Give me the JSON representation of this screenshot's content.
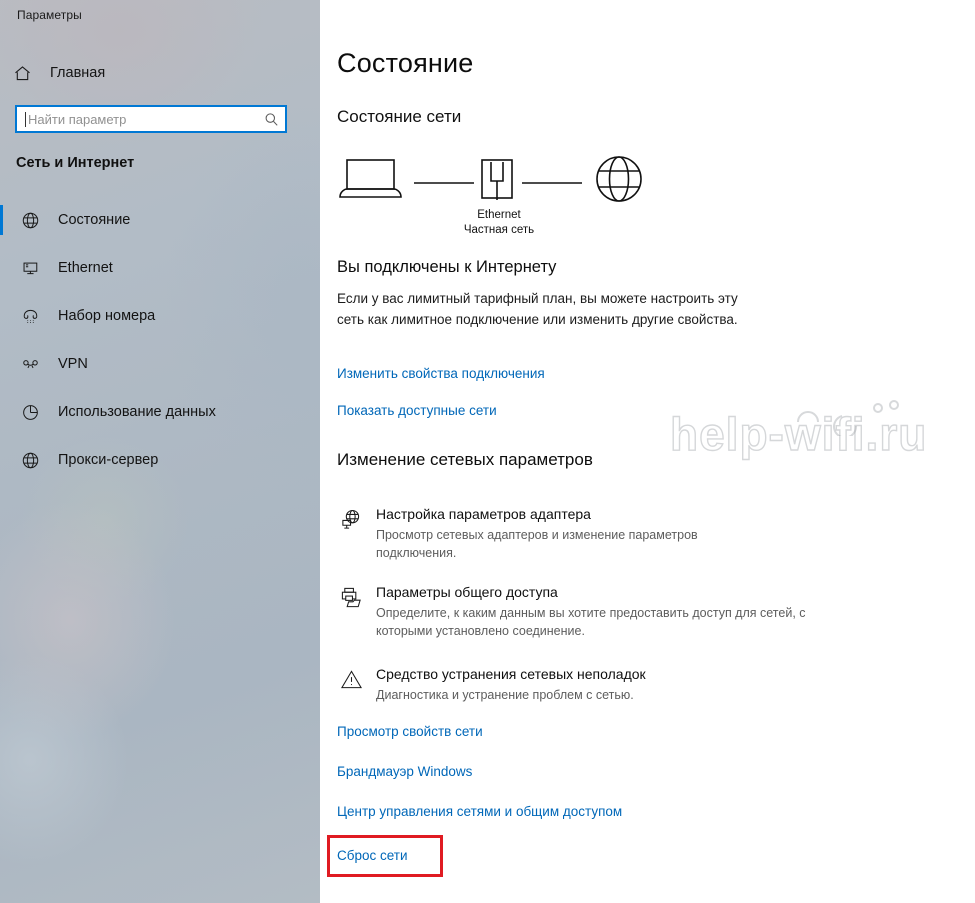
{
  "window": {
    "app_title": "Параметры"
  },
  "sidebar": {
    "home": {
      "label": "Главная",
      "icon": "home-icon"
    },
    "search": {
      "value": "",
      "placeholder": "Найти параметр",
      "icon": "search-icon"
    },
    "section_header": "Сеть и Интернет",
    "items": [
      {
        "label": "Состояние",
        "icon": "globe-icon",
        "selected": true
      },
      {
        "label": "Ethernet",
        "icon": "monitor-plug-icon",
        "selected": false
      },
      {
        "label": "Набор номера",
        "icon": "phone-icon",
        "selected": false
      },
      {
        "label": "VPN",
        "icon": "vpn-key-icon",
        "selected": false
      },
      {
        "label": "Использование данных",
        "icon": "pie-chart-icon",
        "selected": false
      },
      {
        "label": "Прокси-сервер",
        "icon": "globe-icon",
        "selected": false
      }
    ],
    "accent_color": "#0078d4"
  },
  "main": {
    "page_title": "Состояние",
    "network_status_title": "Состояние сети",
    "diagram": {
      "device_icon": "laptop-icon",
      "adapter_icon": "ethernet-port-icon",
      "internet_icon": "globe-icon",
      "connection_name": "Ethernet",
      "network_type": "Частная сеть"
    },
    "connected_heading": "Вы подключены к Интернету",
    "connected_description": "Если у вас лимитный тарифный план, вы можете настроить эту сеть как лимитное подключение или изменить другие свойства.",
    "link_change_properties": "Изменить свойства подключения",
    "link_show_networks": "Показать доступные сети",
    "change_settings_title": "Изменение сетевых параметров",
    "options": [
      {
        "icon": "adapter-globe-icon",
        "title": "Настройка параметров адаптера",
        "description": "Просмотр сетевых адаптеров и изменение параметров подключения."
      },
      {
        "icon": "printer-folder-icon",
        "title": "Параметры общего доступа",
        "description": "Определите, к каким данным вы хотите предоставить доступ для сетей, с которыми установлено соединение."
      },
      {
        "icon": "warning-triangle-icon",
        "title": "Средство устранения сетевых неполадок",
        "description": "Диагностика и устранение проблем с сетью."
      }
    ],
    "bottom_links": [
      "Просмотр свойств сети",
      "Брандмауэр Windows",
      "Центр управления сетями и общим доступом",
      "Сброс сети"
    ],
    "link_color": "#0067b8",
    "highlight": {
      "target": "Сброс сети",
      "color": "#e01b22"
    }
  },
  "watermark": {
    "text": "help-wifi.ru"
  }
}
